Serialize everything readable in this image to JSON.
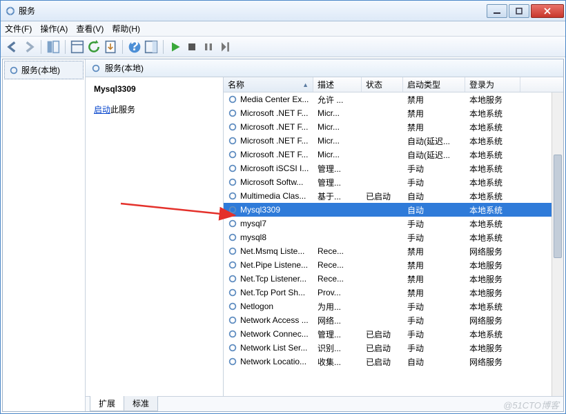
{
  "title": "服务",
  "menu": {
    "file": "文件(F)",
    "action": "操作(A)",
    "view": "查看(V)",
    "help": "帮助(H)"
  },
  "tree": {
    "root": "服务(本地)"
  },
  "header": {
    "label": "服务(本地)"
  },
  "detail": {
    "name": "Mysql3309",
    "start_link": "启动",
    "start_suffix": "此服务"
  },
  "columns": {
    "name": "名称",
    "desc": "描述",
    "status": "状态",
    "startup": "启动类型",
    "logon": "登录为"
  },
  "tabs": {
    "ext": "扩展",
    "std": "标准"
  },
  "watermark": "@51CTO博客",
  "rows": [
    {
      "n": "Media Center Ex...",
      "d": "允许 ...",
      "s": "",
      "t": "禁用",
      "l": "本地服务"
    },
    {
      "n": "Microsoft .NET F...",
      "d": "Micr...",
      "s": "",
      "t": "禁用",
      "l": "本地系统"
    },
    {
      "n": "Microsoft .NET F...",
      "d": "Micr...",
      "s": "",
      "t": "禁用",
      "l": "本地系统"
    },
    {
      "n": "Microsoft .NET F...",
      "d": "Micr...",
      "s": "",
      "t": "自动(延迟...",
      "l": "本地系统"
    },
    {
      "n": "Microsoft .NET F...",
      "d": "Micr...",
      "s": "",
      "t": "自动(延迟...",
      "l": "本地系统"
    },
    {
      "n": "Microsoft iSCSI I...",
      "d": "管理...",
      "s": "",
      "t": "手动",
      "l": "本地系统"
    },
    {
      "n": "Microsoft Softw...",
      "d": "管理...",
      "s": "",
      "t": "手动",
      "l": "本地系统"
    },
    {
      "n": "Multimedia Clas...",
      "d": "基于...",
      "s": "已启动",
      "t": "自动",
      "l": "本地系统"
    },
    {
      "n": "Mysql3309",
      "d": "",
      "s": "",
      "t": "自动",
      "l": "本地系统",
      "sel": true
    },
    {
      "n": "mysql7",
      "d": "",
      "s": "",
      "t": "手动",
      "l": "本地系统"
    },
    {
      "n": "mysql8",
      "d": "",
      "s": "",
      "t": "手动",
      "l": "本地系统"
    },
    {
      "n": "Net.Msmq Liste...",
      "d": "Rece...",
      "s": "",
      "t": "禁用",
      "l": "网络服务"
    },
    {
      "n": "Net.Pipe Listene...",
      "d": "Rece...",
      "s": "",
      "t": "禁用",
      "l": "本地服务"
    },
    {
      "n": "Net.Tcp Listener...",
      "d": "Rece...",
      "s": "",
      "t": "禁用",
      "l": "本地服务"
    },
    {
      "n": "Net.Tcp Port Sh...",
      "d": "Prov...",
      "s": "",
      "t": "禁用",
      "l": "本地服务"
    },
    {
      "n": "Netlogon",
      "d": "为用...",
      "s": "",
      "t": "手动",
      "l": "本地系统"
    },
    {
      "n": "Network Access ...",
      "d": "网络...",
      "s": "",
      "t": "手动",
      "l": "网络服务"
    },
    {
      "n": "Network Connec...",
      "d": "管理...",
      "s": "已启动",
      "t": "手动",
      "l": "本地系统"
    },
    {
      "n": "Network List Ser...",
      "d": "识别...",
      "s": "已启动",
      "t": "手动",
      "l": "本地服务"
    },
    {
      "n": "Network Locatio...",
      "d": "收集...",
      "s": "已启动",
      "t": "自动",
      "l": "网络服务"
    }
  ]
}
